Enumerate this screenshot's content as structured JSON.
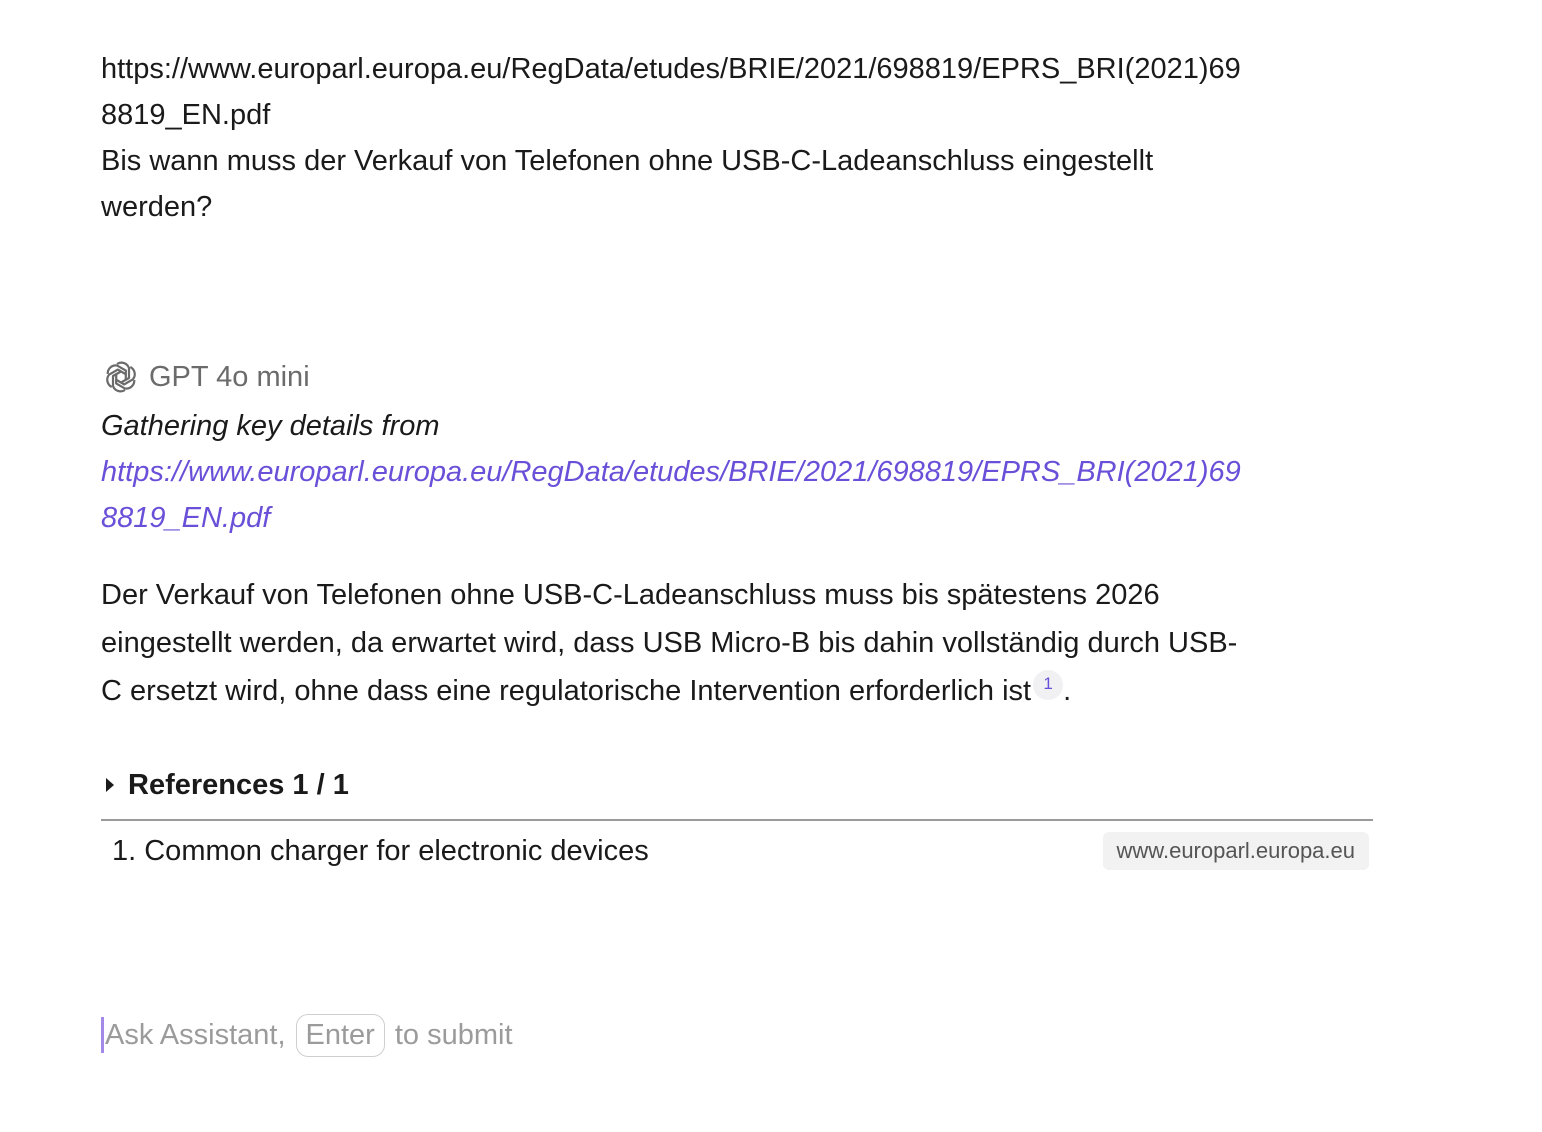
{
  "user_message": {
    "url_line1": "https://www.europarl.europa.eu/RegData/etudes/BRIE/2021/698819/EPRS_BRI(2021)69",
    "url_line2": "8819_EN.pdf",
    "question_line1": "Bis wann muss der Verkauf von Telefonen ohne USB-C-Ladeanschluss eingestellt",
    "question_line2": "werden?"
  },
  "assistant": {
    "model_icon": "openai-logo-icon",
    "model_name": "GPT 4o mini",
    "gathering_prefix": "Gathering key details from",
    "gathering_link_line1": "https://www.europarl.europa.eu/RegData/etudes/BRIE/2021/698819/EPRS_BRI(2021)69",
    "gathering_link_line2": "8819_EN.pdf",
    "answer_line1": "Der Verkauf von Telefonen ohne USB-C-Ladeanschluss muss bis spätestens 2026",
    "answer_line2": "eingestellt werden, da erwartet wird, dass USB Micro-B bis dahin vollständig durch USB-",
    "answer_line3": "C ersetzt wird, ohne dass eine regulatorische Intervention erforderlich ist",
    "citation": "1",
    "answer_end": "."
  },
  "references": {
    "header": "References 1 / 1",
    "items": [
      {
        "title": "1. Common charger for electronic devices",
        "domain": "www.europarl.europa.eu"
      }
    ]
  },
  "input": {
    "placeholder_prefix": "Ask Assistant,",
    "key": "Enter",
    "placeholder_suffix": "to submit"
  },
  "colors": {
    "link": "#6a4fd8",
    "cursor": "#a48ae8",
    "muted": "#9b9b9b"
  }
}
